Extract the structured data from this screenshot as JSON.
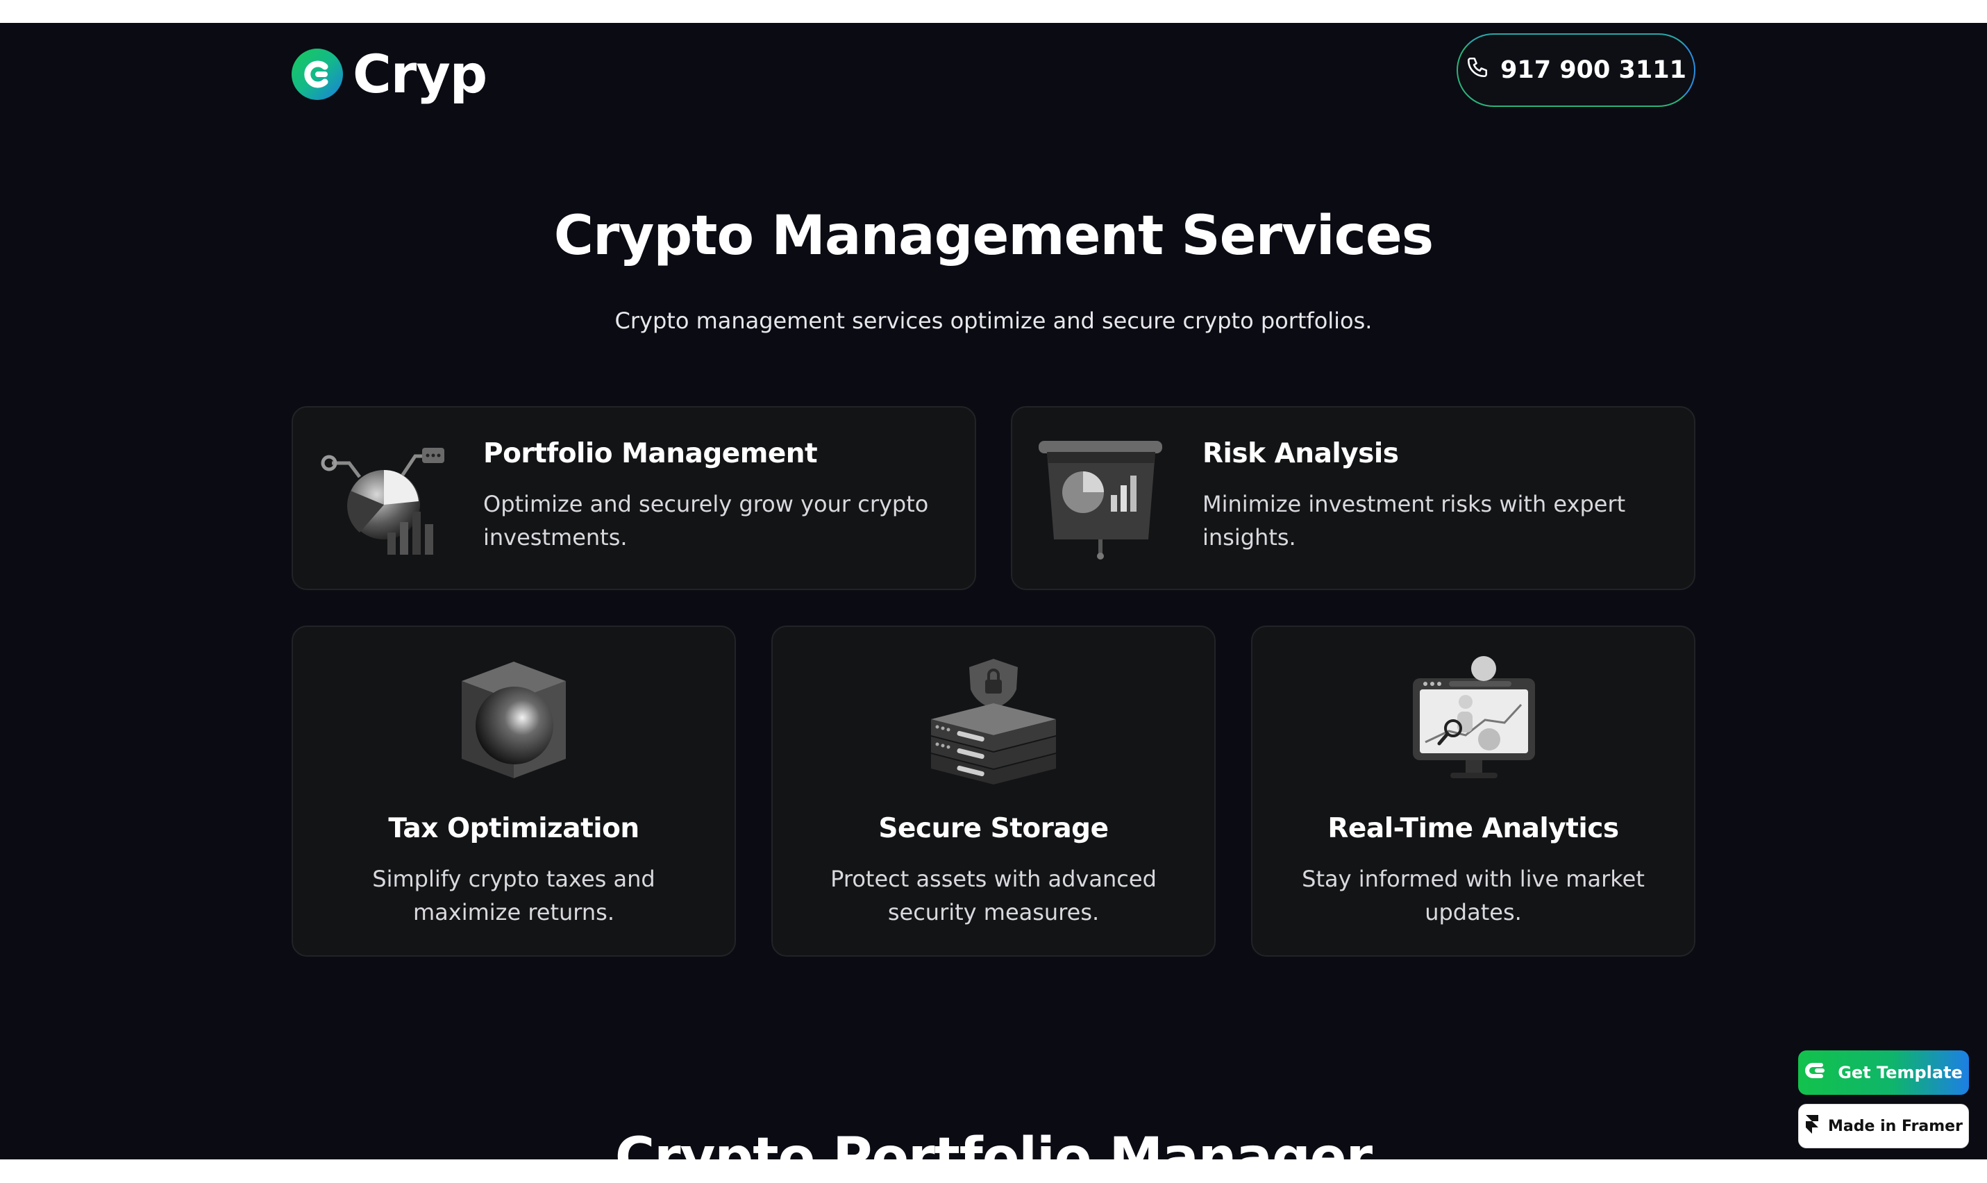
{
  "header": {
    "brand": "Cryp",
    "phone": "917 900 3111"
  },
  "hero": {
    "title": "Crypto Management Services",
    "subtitle": "Crypto management services optimize and secure crypto portfolios."
  },
  "services": [
    {
      "title": "Portfolio Management",
      "description": "Optimize and securely grow your crypto investments.",
      "icon": "portfolio-chart-icon"
    },
    {
      "title": "Risk Analysis",
      "description": "Minimize investment risks with expert insights.",
      "icon": "presentation-board-icon"
    },
    {
      "title": "Tax Optimization",
      "description": "Simplify crypto taxes and maximize returns.",
      "icon": "cube-sphere-icon"
    },
    {
      "title": "Secure Storage",
      "description": "Protect assets with advanced security measures.",
      "icon": "server-shield-icon"
    },
    {
      "title": "Real-Time Analytics",
      "description": "Stay informed with live market updates.",
      "icon": "monitor-analytics-icon"
    }
  ],
  "next_section": {
    "title": "Crypto Portfolio Manager"
  },
  "badges": {
    "get_template": "Get Template",
    "made_in_framer": "Made in Framer"
  },
  "colors": {
    "background": "#0b0b13",
    "card": "#131416",
    "brand_green": "#12c24c",
    "brand_blue": "#1d7fe4"
  }
}
